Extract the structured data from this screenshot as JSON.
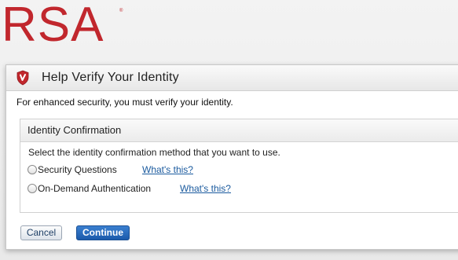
{
  "logo": {
    "text": "RSA",
    "reg": "®"
  },
  "dialog": {
    "title": "Help Verify Your Identity",
    "intro": "For enhanced security, you must verify your identity."
  },
  "panel": {
    "title": "Identity Confirmation",
    "description": "Select the identity confirmation method that you want to use.",
    "options": [
      {
        "label": "Security Questions",
        "help": "What's this?",
        "selected": false
      },
      {
        "label": "On-Demand Authentication",
        "help": "What's this?",
        "selected": false
      }
    ]
  },
  "buttons": {
    "cancel": "Cancel",
    "continue": "Continue"
  },
  "colors": {
    "brand": "#c1272d",
    "link": "#1a5a9e",
    "primary": "#1c5bab"
  },
  "icons": {
    "dialog": "shield-icon"
  }
}
